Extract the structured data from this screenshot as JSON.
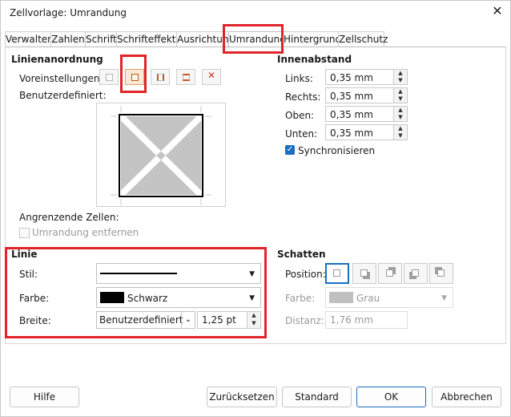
{
  "window": {
    "title": "Zellvorlage: Umrandung",
    "close_glyph": "✕"
  },
  "tabs": [
    "Verwalten",
    "Zahlen",
    "Schrift",
    "Schrifteffekte",
    "Ausrichtung",
    "Umrandung",
    "Hintergrund",
    "Zellschutz"
  ],
  "line_arrangement": {
    "header": "Linienanordnung",
    "presets_label": "Voreinstellungen:",
    "user_defined_label": "Benutzerdefiniert:",
    "adjacent_label": "Angrenzende Zellen:",
    "remove_border_label": "Umrandung entfernen"
  },
  "padding": {
    "header": "Innenabstand",
    "left_label": "Links:",
    "left_value": "0,35 mm",
    "right_label": "Rechts:",
    "right_value": "0,35 mm",
    "top_label": "Oben:",
    "top_value": "0,35 mm",
    "bottom_label": "Unten:",
    "bottom_value": "0,35 mm",
    "sync_label": "Synchronisieren"
  },
  "line": {
    "header": "Linie",
    "style_label": "Stil:",
    "color_label": "Farbe:",
    "color_value": "Schwarz",
    "color_swatch": "#000000",
    "width_label": "Breite:",
    "width_select": "Benutzerdefiniert",
    "width_value": "1,25 pt"
  },
  "shadow": {
    "header": "Schatten",
    "position_label": "Position:",
    "color_label": "Farbe:",
    "color_value": "Grau",
    "color_swatch": "#c0c0c0",
    "distance_label": "Distanz:",
    "distance_value": "1,76 mm"
  },
  "buttons": {
    "help": "Hilfe",
    "reset": "Zurücksetzen",
    "standard": "Standard",
    "ok": "OK",
    "cancel": "Abbrechen"
  },
  "colors": {
    "highlight": "#e0242a",
    "accent": "#1a6fc0"
  }
}
